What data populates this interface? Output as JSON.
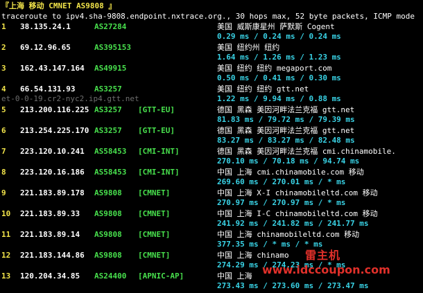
{
  "header": "『上海 移动 CMNET AS9808 』",
  "command": "traceroute to ipv4.sha-9808.endpoint.nxtrace.org., 30 hops max, 52 byte packets, ICMP mode",
  "hops": [
    {
      "n": "1",
      "ip": "38.135.24.1",
      "asn": "AS27284",
      "tag": "",
      "geo": "美国 威斯康星州 萨默斯  Cogent",
      "rtt": "0.29 ms / 0.24 ms / 0.24 ms",
      "host": ""
    },
    {
      "n": "2",
      "ip": "69.12.96.65",
      "asn": "AS395153",
      "tag": "",
      "geo": "美国 纽约州 纽约",
      "rtt": "1.64 ms / 1.26 ms / 1.23 ms",
      "host": ""
    },
    {
      "n": "3",
      "ip": "162.43.147.164",
      "asn": "AS49915",
      "tag": "",
      "geo": "美国 纽约 纽约   megaport.com",
      "rtt": "0.50 ms / 0.41 ms / 0.30 ms",
      "host": ""
    },
    {
      "n": "4",
      "ip": "66.54.131.93",
      "asn": "AS3257",
      "tag": "",
      "geo": "美国 纽约 纽约   gtt.net",
      "rtt": "1.22 ms / 9.94 ms / 0.88 ms",
      "host": "et-0-0-19.cr2-nyc2.ip4.gtt.net"
    },
    {
      "n": "5",
      "ip": "213.200.116.225",
      "asn": "AS3257",
      "tag": "[GTT-EU]",
      "geo": "德国 黑森 美因河畔法兰克福  gtt.net",
      "rtt": "81.83 ms / 79.72 ms / 79.39 ms",
      "host": ""
    },
    {
      "n": "6",
      "ip": "213.254.225.170",
      "asn": "AS3257",
      "tag": "[GTT-EU]",
      "geo": "德国 黑森 美因河畔法兰克福  gtt.net",
      "rtt": "83.27 ms / 83.27 ms / 82.48 ms",
      "host": ""
    },
    {
      "n": "7",
      "ip": "223.120.10.241",
      "asn": "AS58453",
      "tag": "[CMI-INT]",
      "geo": "德国 黑森 美因河畔法兰克福  cmi.chinamobile.",
      "rtt": "270.10 ms / 70.18 ms / 94.74 ms",
      "host": ""
    },
    {
      "n": "8",
      "ip": "223.120.16.186",
      "asn": "AS58453",
      "tag": "[CMI-INT]",
      "geo": "中国 上海   cmi.chinamobile.com  移动",
      "rtt": "269.60 ms / 270.01 ms / * ms",
      "host": ""
    },
    {
      "n": "9",
      "ip": "221.183.89.178",
      "asn": "AS9808",
      "tag": "[CMNET]",
      "geo": "中国 上海  X-I chinamobileltd.com  移动",
      "rtt": "270.97 ms / 270.97 ms / * ms",
      "host": ""
    },
    {
      "n": "10",
      "ip": "221.183.89.33",
      "asn": "AS9808",
      "tag": "[CMNET]",
      "geo": "中国 上海  I-C chinamobileltd.com  移动",
      "rtt": "241.92 ms / 241.82 ms / 241.77 ms",
      "host": ""
    },
    {
      "n": "11",
      "ip": "221.183.89.14",
      "asn": "AS9808",
      "tag": "[CMNET]",
      "geo": "中国 上海    chinamobileltd.com  移动",
      "rtt": "377.35 ms / * ms / * ms",
      "host": ""
    },
    {
      "n": "12",
      "ip": "221.183.144.86",
      "asn": "AS9808",
      "tag": "[CMNET]",
      "geo": "中国 上海    chinamo",
      "rtt": "274.29 ms / 274.23 ms / * ms",
      "host": ""
    },
    {
      "n": "13",
      "ip": "120.204.34.85",
      "asn": "AS24400",
      "tag": "[APNIC-AP]",
      "geo": "中国 上海    ",
      "rtt": "273.43 ms / 273.60 ms / 273.47 ms",
      "host": ""
    }
  ],
  "watermark": {
    "brand": "雷主机",
    "url": "www.idccoupon.com"
  }
}
